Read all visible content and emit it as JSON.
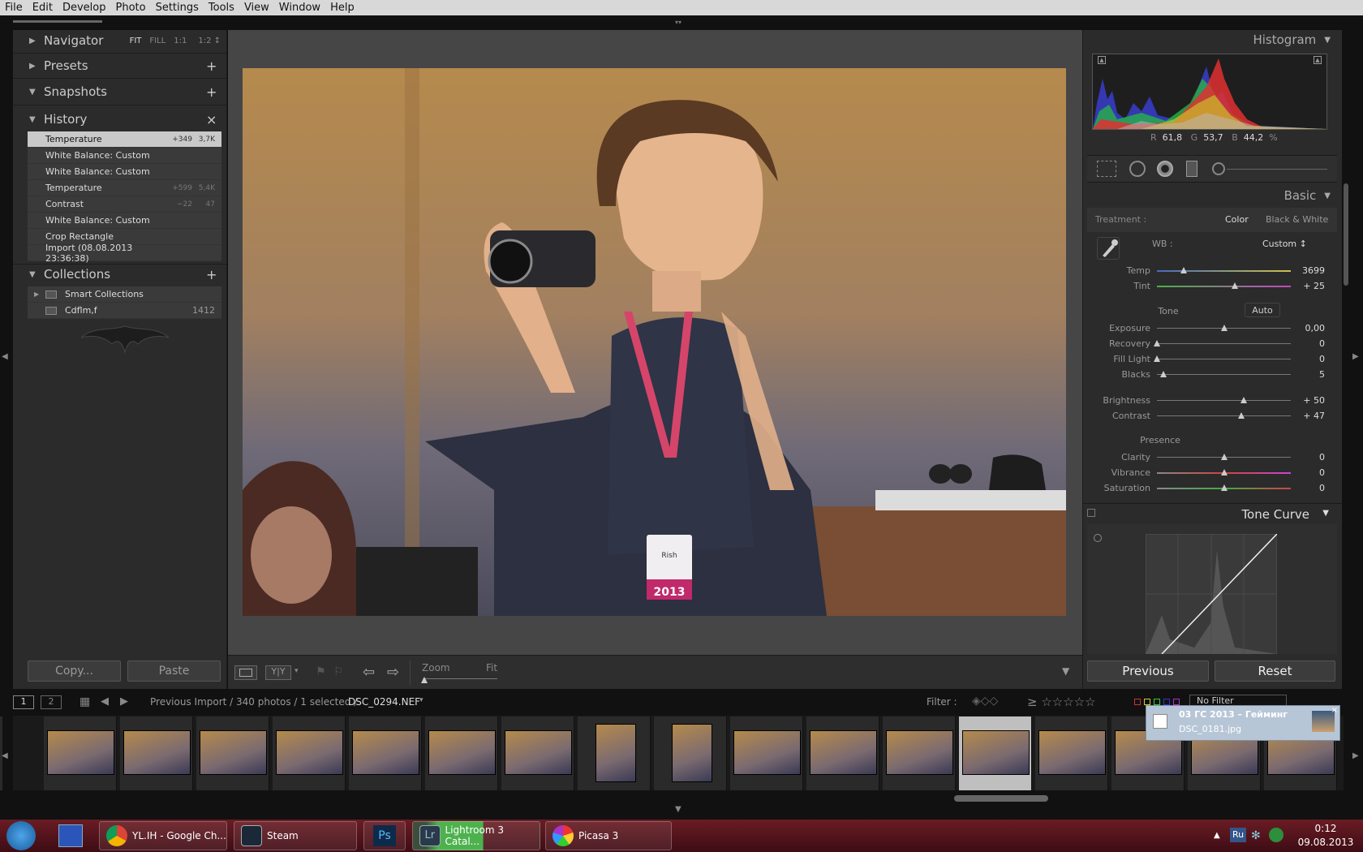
{
  "menu": [
    "File",
    "Edit",
    "Develop",
    "Photo",
    "Settings",
    "Tools",
    "View",
    "Window",
    "Help"
  ],
  "left": {
    "navigator": {
      "title": "Navigator",
      "opts": [
        "FIT",
        "FILL",
        "1:1",
        "1:2 ↕"
      ]
    },
    "presets": {
      "title": "Presets"
    },
    "snapshots": {
      "title": "Snapshots"
    },
    "history": {
      "title": "History",
      "rows": [
        {
          "name": "Temperature",
          "v1": "+349",
          "v2": "3,7K"
        },
        {
          "name": "White Balance: Custom",
          "v1": "",
          "v2": ""
        },
        {
          "name": "White Balance: Custom",
          "v1": "",
          "v2": ""
        },
        {
          "name": "Temperature",
          "v1": "+599",
          "v2": "5,4K"
        },
        {
          "name": "Contrast",
          "v1": "−22",
          "v2": "47"
        },
        {
          "name": "White Balance: Custom",
          "v1": "",
          "v2": ""
        },
        {
          "name": "Crop Rectangle",
          "v1": "",
          "v2": ""
        },
        {
          "name": "Import (08.08.2013 23:36:38)",
          "v1": "",
          "v2": ""
        }
      ]
    },
    "collections": {
      "title": "Collections",
      "rows": [
        {
          "name": "Smart Collections",
          "count": ""
        },
        {
          "name": "Cdflm,f",
          "count": "1412"
        }
      ]
    },
    "copy": "Copy...",
    "paste": "Paste"
  },
  "photo": {
    "badge_name": "Rish",
    "badge_year": "2013"
  },
  "toolbar": {
    "zoom_label": "Zoom",
    "zoom_value": "Fit"
  },
  "right": {
    "histogram": {
      "title": "Histogram",
      "r": "61,8",
      "g": "53,7",
      "b": "44,2",
      "pct": "%",
      "r_label": "R",
      "g_label": "G",
      "b_label": "B"
    },
    "basic": {
      "title": "Basic",
      "treatment": "Treatment :",
      "color": "Color",
      "bw": "Black & White",
      "wb_label": "WB :",
      "wb_value": "Custom ↕",
      "temp_label": "Temp",
      "temp_value": "3699",
      "tint_label": "Tint",
      "tint_value": "+ 25",
      "tone": "Tone",
      "auto": "Auto",
      "sliders": [
        {
          "label": "Exposure",
          "value": "0,00",
          "pos": 0.5
        },
        {
          "label": "Recovery",
          "value": "0",
          "pos": 0.0
        },
        {
          "label": "Fill Light",
          "value": "0",
          "pos": 0.0
        },
        {
          "label": "Blacks",
          "value": "5",
          "pos": 0.05
        },
        {
          "label": "Brightness",
          "value": "+ 50",
          "pos": 0.65
        },
        {
          "label": "Contrast",
          "value": "+ 47",
          "pos": 0.63
        },
        {
          "label": "Clarity",
          "value": "0",
          "pos": 0.5
        },
        {
          "label": "Vibrance",
          "value": "0",
          "pos": 0.5
        },
        {
          "label": "Saturation",
          "value": "0",
          "pos": 0.5
        }
      ],
      "presence": "Presence",
      "temp_pos": 0.2,
      "tint_pos": 0.58
    },
    "tonecurve": {
      "title": "Tone Curve"
    },
    "previous": "Previous",
    "reset": "Reset"
  },
  "filmbar": {
    "pages": [
      "1",
      "2"
    ],
    "path": "Previous Import / 340 photos / 1 selected / ",
    "file": "DSC_0294.NEF",
    "filter": "Filter :",
    "nofilter": "No Filter",
    "stars": "≥ ☆☆☆☆☆"
  },
  "notification": {
    "title": "03 ГС 2013 – Гейминг",
    "file": "DSC_0181.jpg"
  },
  "taskbar": {
    "items": [
      {
        "label": "YL.IH - Google Ch..."
      },
      {
        "label": "Steam"
      },
      {
        "label": "Ps"
      },
      {
        "label": "Lightroom 3 Catal..."
      },
      {
        "label": "Picasa 3"
      }
    ],
    "lang": "Ru",
    "time": "0:12",
    "date": "09.08.2013"
  }
}
